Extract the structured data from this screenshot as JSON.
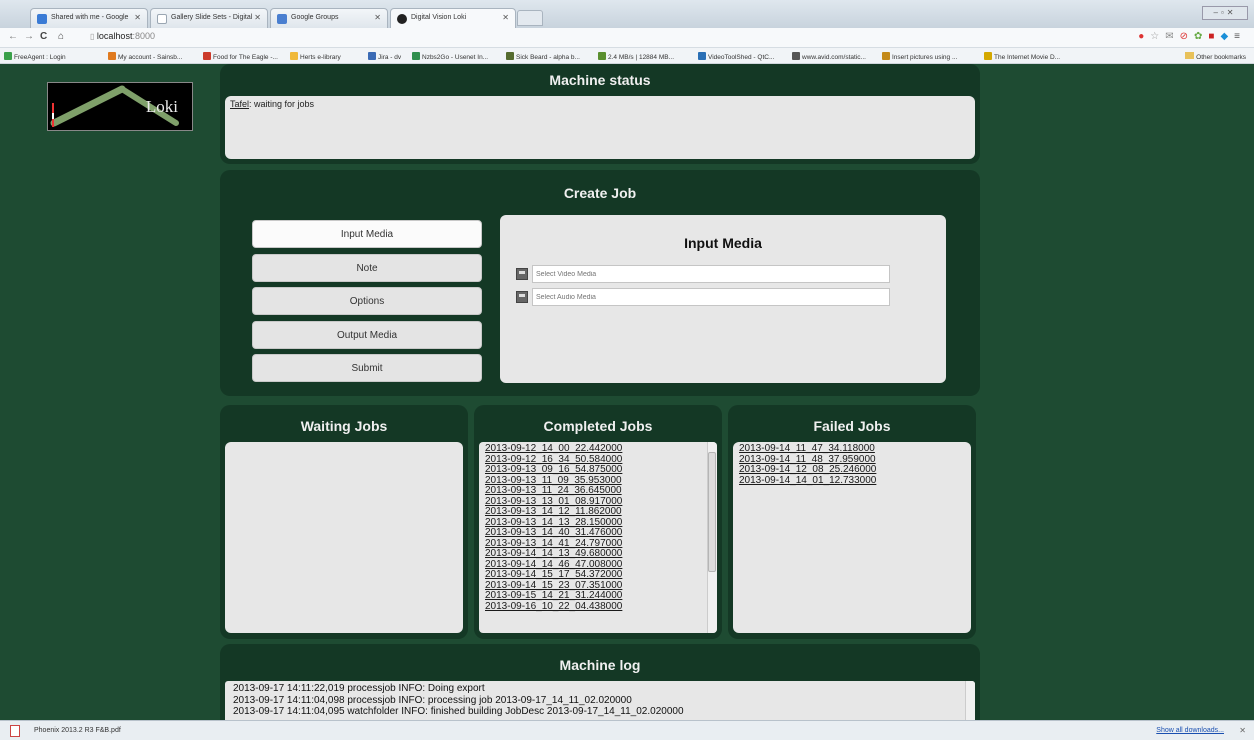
{
  "browser": {
    "tabs": [
      {
        "label": "Shared with me - Google",
        "color": "#3a7bd5"
      },
      {
        "label": "Gallery Slide Sets - Digital",
        "color": "#9aa6b2"
      },
      {
        "label": "Google Groups",
        "color": "#4a7fd0"
      },
      {
        "label": "Digital Vision Loki",
        "color": "#222222"
      }
    ],
    "address": {
      "host": "localhost",
      "port": ":8000"
    },
    "bookmarks": [
      {
        "label": "FreeAgent : Login",
        "color": "#3aa04a"
      },
      {
        "label": "My account - Sainsb...",
        "color": "#e07a1f"
      },
      {
        "label": "Food for The Eagle -...",
        "color": "#cc3b2b"
      },
      {
        "label": "Herts e-library",
        "color": "#f0b93a"
      },
      {
        "label": "Jira - dv",
        "color": "#3b6bb5"
      },
      {
        "label": "Nzbs2Go - Usenet In...",
        "color": "#2f8f4e"
      },
      {
        "label": "Sick Beard - alpha b...",
        "color": "#556b2f"
      },
      {
        "label": "2.4 MB/s | 12884 MB...",
        "color": "#5a8f2f"
      },
      {
        "label": "VideoToolShed - QtC...",
        "color": "#2a6fb5"
      },
      {
        "label": "www.avid.com/static...",
        "color": "#555555"
      },
      {
        "label": "Insert pictures using ...",
        "color": "#c48a1a"
      },
      {
        "label": "The Internet Movie D...",
        "color": "#d4a800"
      }
    ],
    "bookmarks_other": "Other bookmarks"
  },
  "logo": {
    "text": "Loki"
  },
  "machine_status": {
    "title": "Machine status",
    "machine_name": "Tafel",
    "message": ": waiting for jobs"
  },
  "create_job": {
    "title": "Create Job",
    "buttons": [
      "Input Media",
      "Note",
      "Options",
      "Output Media",
      "Submit"
    ],
    "active_button": "Input Media",
    "input_media": {
      "title": "Input Media",
      "video_placeholder": "Select Video Media",
      "audio_placeholder": "Select Audio Media"
    }
  },
  "waiting_jobs": {
    "title": "Waiting Jobs",
    "items": []
  },
  "completed_jobs": {
    "title": "Completed Jobs",
    "items": [
      "2013-09-12_14_00_22.442000",
      "2013-09-12_16_34_50.584000",
      "2013-09-13_09_16_54.875000",
      "2013-09-13_11_09_35.953000",
      "2013-09-13_11_24_36.645000",
      "2013-09-13_13_01_08.917000",
      "2013-09-13_14_12_11.862000",
      "2013-09-13_14_13_28.150000",
      "2013-09-13_14_40_31.476000",
      "2013-09-13_14_41_24.797000",
      "2013-09-14_14_13_49.680000",
      "2013-09-14_14_46_47.008000",
      "2013-09-14_15_17_54.372000",
      "2013-09-14_15_23_07.351000",
      "2013-09-15_14_21_31.244000",
      "2013-09-16_10_22_04.438000"
    ]
  },
  "failed_jobs": {
    "title": "Failed Jobs",
    "items": [
      "2013-09-14_11_47_34.118000",
      "2013-09-14_11_48_37.959000",
      "2013-09-14_12_08_25.246000",
      "2013-09-14_14_01_12.733000"
    ]
  },
  "machine_log": {
    "title": "Machine log",
    "lines": [
      "2013-09-17 14:11:22,019 processjob INFO: Doing export",
      "2013-09-17 14:11:04,098 processjob INFO: processing job 2013-09-17_14_11_02.020000",
      "2013-09-17 14:11:04,095 watchfolder INFO: finished building JobDesc 2013-09-17_14_11_02.020000"
    ]
  },
  "downloads": {
    "item": "Phoenix 2013.2 R3 F&B.pdf",
    "show_all": "Show all downloads..."
  }
}
